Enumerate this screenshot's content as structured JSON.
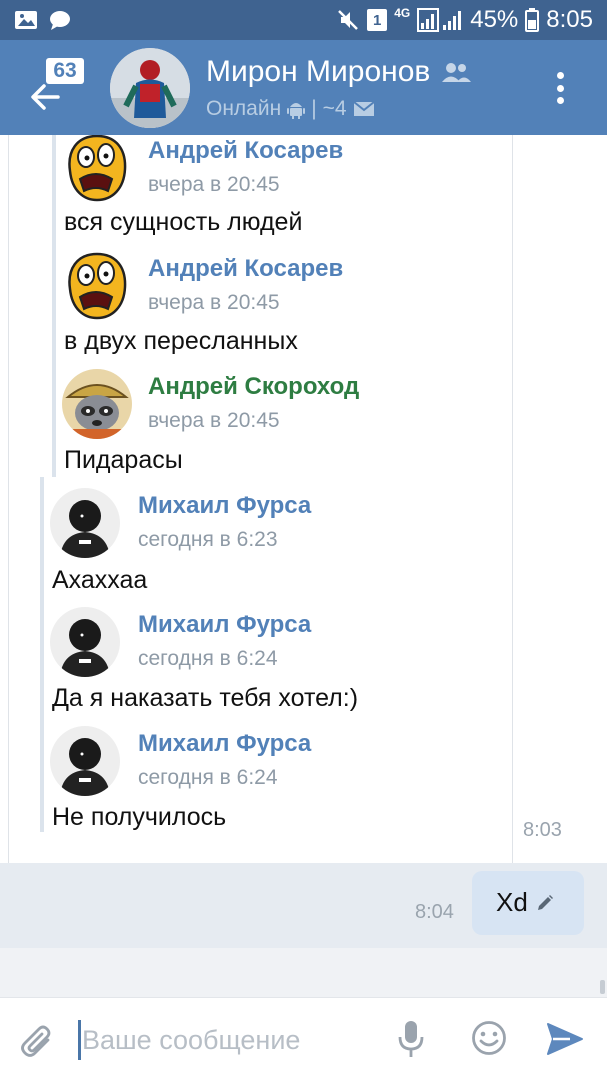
{
  "status_bar": {
    "sim_badge": "1",
    "network": "4G",
    "battery": "45%",
    "time": "8:05"
  },
  "toolbar": {
    "unread_count": "63",
    "chat_name": "Мирон Миронов",
    "status_online": "Онлайн",
    "separator": "|",
    "mentions": "~4"
  },
  "forwarded": [
    {
      "author": "Андрей Косарев",
      "time": "вчера в 20:45",
      "text": "вся сущность людей",
      "avatar": "rage-face"
    },
    {
      "author": "Андрей Косарев",
      "time": "вчера в 20:45",
      "text": "в двух пересланных",
      "avatar": "rage-face"
    },
    {
      "author": "Андрей Скороход",
      "time": "вчера в 20:45",
      "text": "Пидарасы",
      "avatar": "raccoon-hat"
    },
    {
      "author": "Михаил Фурса",
      "time": "сегодня в 6:23",
      "text": "Ахаххаа",
      "avatar": "hooded-person"
    },
    {
      "author": "Михаил Фурса",
      "time": "сегодня в 6:24",
      "text": "Да я наказать тебя хотел:)",
      "avatar": "hooded-person"
    },
    {
      "author": "Михаил Фурса",
      "time": "сегодня в 6:24",
      "text": "Не получилось",
      "avatar": "hooded-person"
    }
  ],
  "incoming_time": "8:03",
  "outgoing": {
    "text": "Xd",
    "time": "8:04"
  },
  "input": {
    "placeholder": "Ваше сообщение"
  },
  "colors": {
    "header": "#5281b8",
    "status_bar": "#3f6390",
    "name_blue": "#5281b8",
    "name_green": "#2e7d42",
    "outgoing_bubble": "#d7e4f3"
  }
}
